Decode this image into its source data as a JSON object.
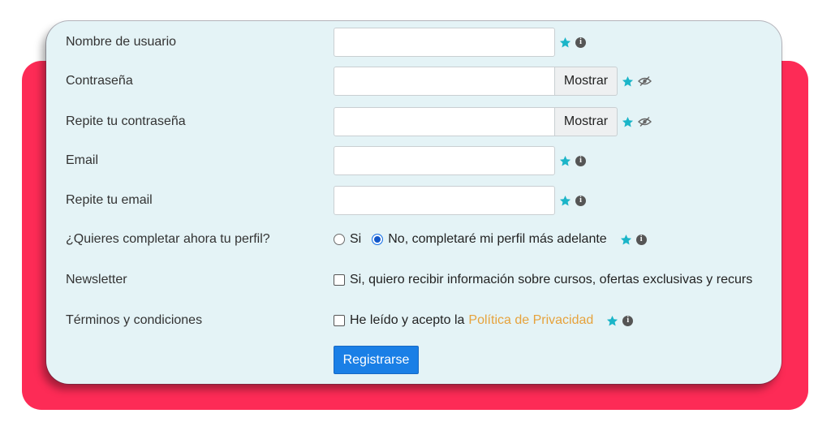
{
  "colors": {
    "backdrop": "#fd2b56",
    "card": "#e4f3f6",
    "required_star": "#1bb5c8",
    "link": "#e6a23c",
    "primary_button": "#1a7fe6"
  },
  "form": {
    "username": {
      "label": "Nombre de usuario",
      "value": "",
      "icons": [
        "star-icon",
        "info-icon"
      ]
    },
    "password": {
      "label": "Contraseña",
      "value": "",
      "show_label": "Mostrar",
      "icons": [
        "star-icon",
        "eye-slash-icon"
      ]
    },
    "password_repeat": {
      "label": "Repite tu contraseña",
      "value": "",
      "show_label": "Mostrar",
      "icons": [
        "star-icon",
        "eye-slash-icon"
      ]
    },
    "email": {
      "label": "Email",
      "value": "",
      "icons": [
        "star-icon",
        "info-icon"
      ]
    },
    "email_repeat": {
      "label": "Repite tu email",
      "value": "",
      "icons": [
        "star-icon",
        "info-icon"
      ]
    },
    "complete_profile": {
      "label": "¿Quieres completar ahora tu perfil?",
      "options": [
        {
          "label": "Si",
          "selected": false
        },
        {
          "label": "No, completaré mi perfil más adelante",
          "selected": true
        }
      ],
      "icons": [
        "star-icon",
        "info-icon"
      ]
    },
    "newsletter": {
      "label": "Newsletter",
      "checkbox_label": "Si, quiero recibir información sobre cursos, ofertas exclusivas y recurs",
      "checked": false
    },
    "terms": {
      "label": "Términos y condiciones",
      "checkbox_label": "He leído y acepto la",
      "link_text": "Política de Privacidad",
      "checked": false,
      "icons": [
        "star-icon",
        "info-icon"
      ]
    },
    "submit_label": "Registrarse"
  }
}
